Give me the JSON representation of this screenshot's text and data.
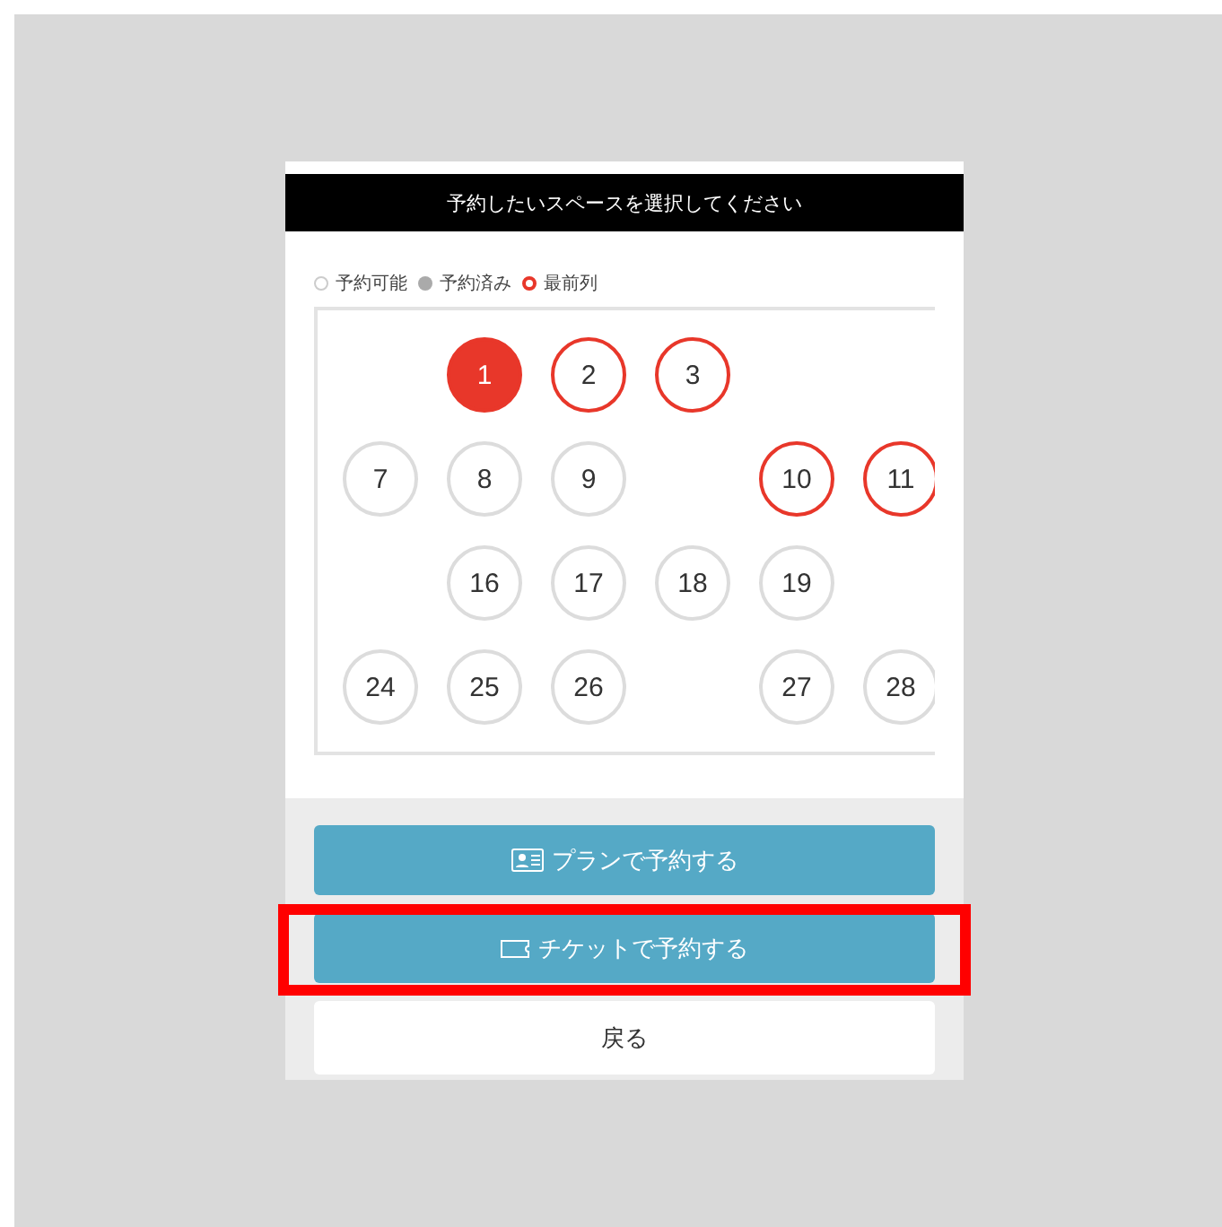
{
  "header": {
    "title": "予約したいスペースを選択してください"
  },
  "legend": [
    {
      "label": "予約可能",
      "kind": "available"
    },
    {
      "label": "予約済み",
      "kind": "reserved"
    },
    {
      "label": "最前列",
      "kind": "front"
    }
  ],
  "seat_rows": [
    {
      "seats": [
        {
          "kind": "gap"
        },
        {
          "kind": "seat",
          "number": "1",
          "selected": true,
          "front_row": true
        },
        {
          "kind": "seat",
          "number": "2",
          "selected": false,
          "front_row": true
        },
        {
          "kind": "seat",
          "number": "3",
          "selected": false,
          "front_row": true
        }
      ]
    },
    {
      "seats": [
        {
          "kind": "seat",
          "number": "7",
          "selected": false,
          "front_row": false
        },
        {
          "kind": "seat",
          "number": "8",
          "selected": false,
          "front_row": false
        },
        {
          "kind": "seat",
          "number": "9",
          "selected": false,
          "front_row": false
        },
        {
          "kind": "gap"
        },
        {
          "kind": "seat",
          "number": "10",
          "selected": false,
          "front_row": true
        },
        {
          "kind": "seat",
          "number": "11",
          "selected": false,
          "front_row": true
        }
      ]
    },
    {
      "seats": [
        {
          "kind": "gap"
        },
        {
          "kind": "seat",
          "number": "16",
          "selected": false,
          "front_row": false
        },
        {
          "kind": "seat",
          "number": "17",
          "selected": false,
          "front_row": false
        },
        {
          "kind": "seat",
          "number": "18",
          "selected": false,
          "front_row": false
        },
        {
          "kind": "seat",
          "number": "19",
          "selected": false,
          "front_row": false
        }
      ]
    },
    {
      "seats": [
        {
          "kind": "seat",
          "number": "24",
          "selected": false,
          "front_row": false
        },
        {
          "kind": "seat",
          "number": "25",
          "selected": false,
          "front_row": false
        },
        {
          "kind": "seat",
          "number": "26",
          "selected": false,
          "front_row": false
        },
        {
          "kind": "gap"
        },
        {
          "kind": "seat",
          "number": "27",
          "selected": false,
          "front_row": false
        },
        {
          "kind": "seat",
          "number": "28",
          "selected": false,
          "front_row": false
        }
      ]
    }
  ],
  "buttons": [
    {
      "label": "プランで予約する",
      "kind": "plan",
      "highlighted": false
    },
    {
      "label": "チケットで予約する",
      "kind": "ticket",
      "highlighted": true
    },
    {
      "label": "戻る",
      "kind": "back",
      "highlighted": false
    }
  ]
}
